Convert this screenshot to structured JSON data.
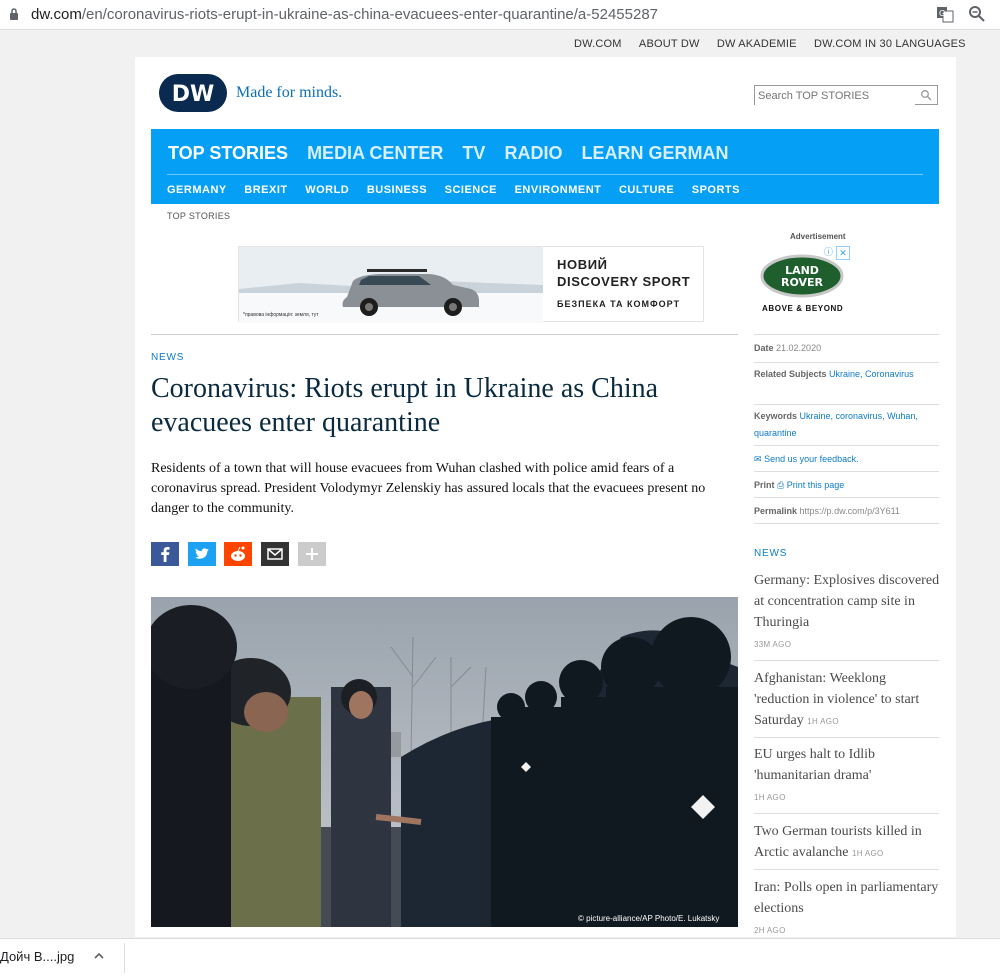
{
  "browser": {
    "url_host": "dw.com",
    "url_path": "/en/coronavirus-riots-erupt-in-ukraine-as-china-evacuees-enter-quarantine/a-52455287"
  },
  "top_links": [
    "DW.COM",
    "ABOUT DW",
    "DW AKADEMIE",
    "DW.COM IN 30 LANGUAGES"
  ],
  "logo": {
    "text": "DW",
    "tagline": "Made for minds."
  },
  "search": {
    "placeholder": "Search TOP STORIES"
  },
  "nav": {
    "main": [
      "TOP STORIES",
      "MEDIA CENTER",
      "TV",
      "RADIO",
      "LEARN GERMAN"
    ],
    "sub": [
      "GERMANY",
      "BREXIT",
      "WORLD",
      "BUSINESS",
      "SCIENCE",
      "ENVIRONMENT",
      "CULTURE",
      "SPORTS"
    ]
  },
  "breadcrumb": "TOP STORIES",
  "ad_banner": {
    "line1": "НОВИЙ",
    "line2": "DISCOVERY SPORT",
    "line3": "БЕЗПЕКА ТА КОМФОРТ",
    "fine_print": "*правова інформація: земля, тут"
  },
  "ad_side": {
    "label": "Advertisement",
    "brand_line1": "LAND",
    "brand_line2": "ROVER",
    "slogan": "ABOVE & BEYOND"
  },
  "article": {
    "kicker": "NEWS",
    "headline": "Coronavirus: Riots erupt in Ukraine as China evacuees enter quarantine",
    "intro": "Residents of a town that will house evacuees from Wuhan clashed with police amid fears of a coronavirus spread. President Volodymyr Zelenskiy has assured locals that the evacuees present no danger to the community.",
    "photo_credit": "© picture-alliance/AP Photo/E. Lukatsky"
  },
  "share": {
    "colors": {
      "facebook": "#3b5998",
      "twitter": "#1da1f2",
      "reddit": "#ff4500",
      "email": "#333333",
      "more": "#cccccc"
    }
  },
  "meta": {
    "date_label": "Date",
    "date_value": "21.02.2020",
    "related_label": "Related Subjects",
    "related_values": "Ukraine, Coronavirus",
    "keywords_label": "Keywords",
    "keywords_values": "Ukraine, coronavirus, Wuhan, quarantine",
    "feedback": "Send us your feedback.",
    "print_label": "Print",
    "print_link": "Print this page",
    "permalink_label": "Permalink",
    "permalink_value": "https://p.dw.com/p/3Y611"
  },
  "sidebar_news": {
    "header": "NEWS",
    "items": [
      {
        "title": "Germany: Explosives discovered at concentration camp site in Thuringia",
        "time": "33M AGO"
      },
      {
        "title": "Afghanistan: Weeklong 'reduction in violence' to start Saturday",
        "time": "1H AGO"
      },
      {
        "title": "EU urges halt to Idlib 'humanitarian drama'",
        "time": "1H AGO"
      },
      {
        "title": "Two German tourists killed in Arctic avalanche",
        "time": "1H AGO"
      },
      {
        "title": "Iran: Polls open in parliamentary elections",
        "time": "2H AGO"
      }
    ]
  },
  "downloads": {
    "file": "Дойч В....jpg"
  },
  "colors": {
    "nav_blue": "#05a0f5",
    "link_blue": "#0e7bc8",
    "headline": "#0a2a3f"
  }
}
